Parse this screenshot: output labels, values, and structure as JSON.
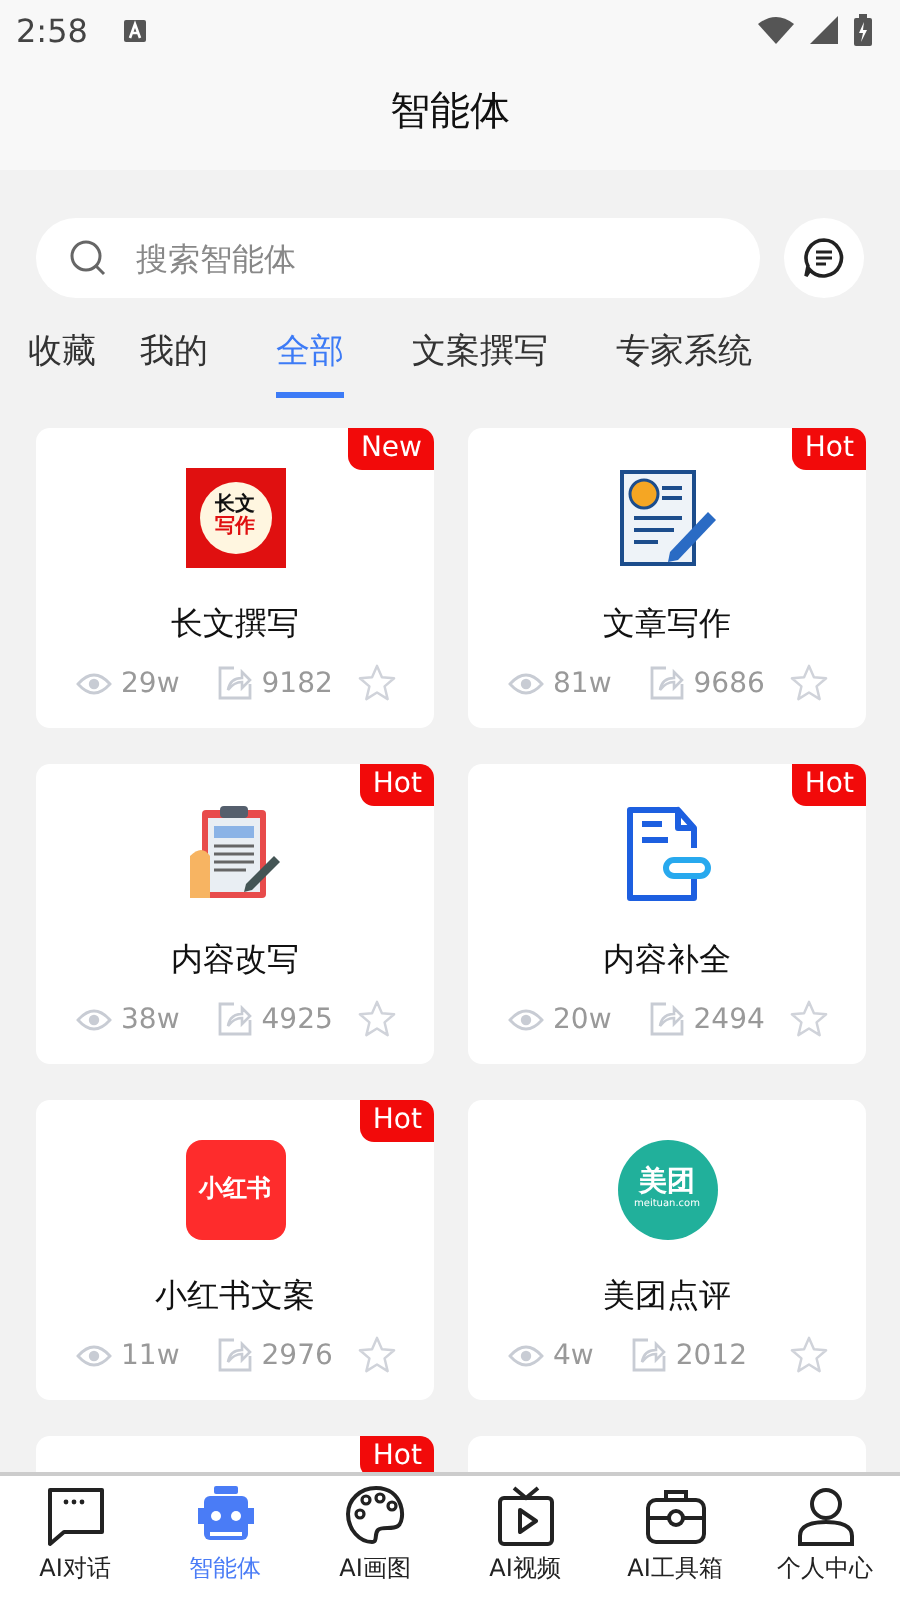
{
  "status_bar": {
    "time": "2:58"
  },
  "header": {
    "title": "智能体"
  },
  "search": {
    "placeholder": "搜索智能体"
  },
  "tabs": [
    {
      "label": "收藏",
      "selected": false
    },
    {
      "label": "我的",
      "selected": false
    },
    {
      "label": "全部",
      "selected": true
    },
    {
      "label": "文案撰写",
      "selected": false
    },
    {
      "label": "专家系统",
      "selected": false
    }
  ],
  "cards": [
    {
      "title": "长文撰写",
      "badge": "New",
      "logo_text": [
        "长文",
        "写作"
      ],
      "views": "29w",
      "shares": "9182"
    },
    {
      "title": "文章写作",
      "badge": "Hot",
      "views": "81w",
      "shares": "9686"
    },
    {
      "title": "内容改写",
      "badge": "Hot",
      "views": "38w",
      "shares": "4925"
    },
    {
      "title": "内容补全",
      "badge": "Hot",
      "views": "20w",
      "shares": "2494"
    },
    {
      "title": "小红书文案",
      "badge": "Hot",
      "logo_text": [
        "小红书"
      ],
      "views": "11w",
      "shares": "2976"
    },
    {
      "title": "美团点评",
      "logo_text": [
        "美团",
        "meituan.com"
      ],
      "views": "4w",
      "shares": "2012"
    }
  ],
  "partial_cards": [
    {
      "kind": "card_top",
      "badge": "Hot"
    },
    {
      "kind": "card_top"
    }
  ],
  "nav": [
    {
      "label": "AI对话",
      "selected": false
    },
    {
      "label": "智能体",
      "selected": true
    },
    {
      "label": "AI画图",
      "selected": false
    },
    {
      "label": "AI视频",
      "selected": false
    },
    {
      "label": "AI工具箱",
      "selected": false
    },
    {
      "label": "个人中心",
      "selected": false
    }
  ]
}
